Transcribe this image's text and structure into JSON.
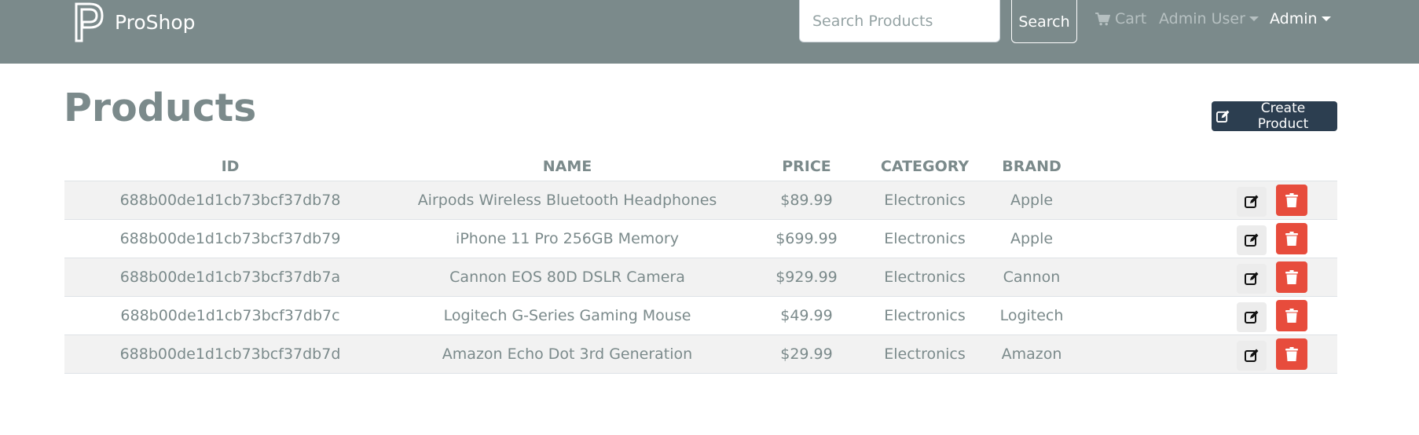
{
  "header": {
    "brand": "ProShop",
    "search": {
      "placeholder": "Search Products",
      "value": ""
    },
    "search_button": "Search",
    "cart_label": "Cart",
    "user_menu_label": "Admin User",
    "admin_menu_label": "Admin"
  },
  "main": {
    "title": "Products",
    "create_button": "Create Product",
    "columns": [
      "ID",
      "NAME",
      "PRICE",
      "CATEGORY",
      "BRAND",
      ""
    ],
    "rows": [
      {
        "id": "688b00de1d1cb73bcf37db78",
        "name": "Airpods Wireless Bluetooth Headphones",
        "price": "$89.99",
        "category": "Electronics",
        "brand": "Apple"
      },
      {
        "id": "688b00de1d1cb73bcf37db79",
        "name": "iPhone 11 Pro 256GB Memory",
        "price": "$699.99",
        "category": "Electronics",
        "brand": "Apple"
      },
      {
        "id": "688b00de1d1cb73bcf37db7a",
        "name": "Cannon EOS 80D DSLR Camera",
        "price": "$929.99",
        "category": "Electronics",
        "brand": "Cannon"
      },
      {
        "id": "688b00de1d1cb73bcf37db7c",
        "name": "Logitech G-Series Gaming Mouse",
        "price": "$49.99",
        "category": "Electronics",
        "brand": "Logitech"
      },
      {
        "id": "688b00de1d1cb73bcf37db7d",
        "name": "Amazon Echo Dot 3rd Generation",
        "price": "$29.99",
        "category": "Electronics",
        "brand": "Amazon"
      }
    ]
  },
  "icons": {
    "brand": "proshop-logo-icon",
    "cart": "shopping-cart-icon",
    "create": "edit-icon",
    "row_edit": "edit-icon",
    "row_delete": "trash-icon"
  },
  "colors": {
    "navbar": "#7b8a8b",
    "primary": "#2c3e50",
    "danger": "#e74c3c",
    "text": "#7b8a8b"
  }
}
